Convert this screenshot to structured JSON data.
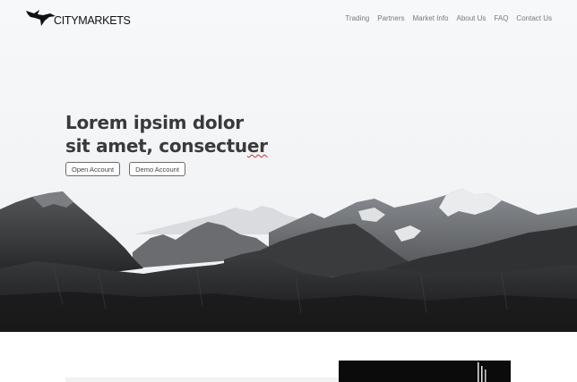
{
  "brand": {
    "name": "CITYMARKETS",
    "logo_icon": "eagle-icon"
  },
  "nav": {
    "items": [
      {
        "label": "Trading"
      },
      {
        "label": "Partners"
      },
      {
        "label": "Market Info"
      },
      {
        "label": "About Us"
      },
      {
        "label": "FAQ"
      },
      {
        "label": "Contact Us"
      }
    ]
  },
  "hero": {
    "headline_line1": "Lorem ipsim dolor",
    "headline_line2_a": "sit amet, consectu",
    "headline_line2_b": "er",
    "buttons": {
      "open_account": "Open Account",
      "demo_account": "Demo Account"
    }
  },
  "colors": {
    "hero_bg": "#f7f8fa",
    "headline": "#3a3a3a",
    "nav_text": "#7a7a7a",
    "panel_dark": "#0b0b0b"
  }
}
